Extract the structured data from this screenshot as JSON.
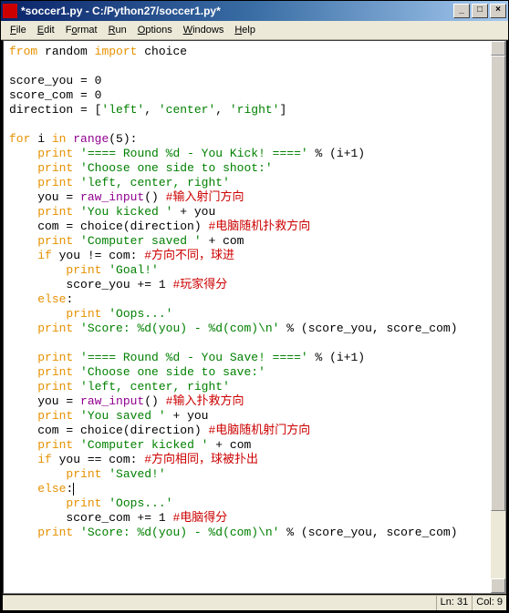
{
  "window": {
    "title": "*soccer1.py - C:/Python27/soccer1.py*",
    "min": "_",
    "max": "□",
    "close": "×"
  },
  "menu": {
    "file": "File",
    "edit": "Edit",
    "format": "Format",
    "run": "Run",
    "options": "Options",
    "windows": "Windows",
    "help": "Help"
  },
  "code": {
    "l1_kw1": "from",
    "l1_id1": " random ",
    "l1_kw2": "import",
    "l1_id2": " choice",
    "l3": "score_you = 0",
    "l4": "score_com = 0",
    "l5_a": "direction = [",
    "l5_s1": "'left'",
    "l5_c1": ", ",
    "l5_s2": "'center'",
    "l5_c2": ", ",
    "l5_s3": "'right'",
    "l5_b": "]",
    "l7_kw1": "for",
    "l7_a": " i ",
    "l7_kw2": "in",
    "l7_b": " ",
    "l7_fn": "range",
    "l7_c": "(5):",
    "l8_a": "    ",
    "l8_kw": "print",
    "l8_b": " ",
    "l8_s": "'==== Round %d - You Kick! ===='",
    "l8_c": " % (i+1)",
    "l9_a": "    ",
    "l9_kw": "print",
    "l9_b": " ",
    "l9_s": "'Choose one side to shoot:'",
    "l10_a": "    ",
    "l10_kw": "print",
    "l10_b": " ",
    "l10_s": "'left, center, right'",
    "l11_a": "    you = ",
    "l11_fn": "raw_input",
    "l11_b": "() ",
    "l11_cm": "#输入射门方向",
    "l12_a": "    ",
    "l12_kw": "print",
    "l12_b": " ",
    "l12_s": "'You kicked '",
    "l12_c": " + you",
    "l13_a": "    com = choice(direction) ",
    "l13_cm": "#电脑随机扑救方向",
    "l14_a": "    ",
    "l14_kw": "print",
    "l14_b": " ",
    "l14_s": "'Computer saved '",
    "l14_c": " + com",
    "l15_a": "    ",
    "l15_kw": "if",
    "l15_b": " you != com: ",
    "l15_cm": "#方向不同，球进",
    "l16_a": "        ",
    "l16_kw": "print",
    "l16_b": " ",
    "l16_s": "'Goal!'",
    "l17_a": "        score_you += 1 ",
    "l17_cm": "#玩家得分",
    "l18_a": "    ",
    "l18_kw": "else",
    "l18_b": ":",
    "l19_a": "        ",
    "l19_kw": "print",
    "l19_b": " ",
    "l19_s": "'Oops...'",
    "l20_a": "    ",
    "l20_kw": "print",
    "l20_b": " ",
    "l20_s": "'Score: %d(you) - %d(com)\\n'",
    "l20_c": " % (score_you, score_com)",
    "l22_a": "    ",
    "l22_kw": "print",
    "l22_b": " ",
    "l22_s": "'==== Round %d - You Save! ===='",
    "l22_c": " % (i+1)",
    "l23_a": "    ",
    "l23_kw": "print",
    "l23_b": " ",
    "l23_s": "'Choose one side to save:'",
    "l24_a": "    ",
    "l24_kw": "print",
    "l24_b": " ",
    "l24_s": "'left, center, right'",
    "l25_a": "    you = ",
    "l25_fn": "raw_input",
    "l25_b": "() ",
    "l25_cm": "#输入扑救方向",
    "l26_a": "    ",
    "l26_kw": "print",
    "l26_b": " ",
    "l26_s": "'You saved '",
    "l26_c": " + you",
    "l27_a": "    com = choice(direction) ",
    "l27_cm": "#电脑随机射门方向",
    "l28_a": "    ",
    "l28_kw": "print",
    "l28_b": " ",
    "l28_s": "'Computer kicked '",
    "l28_c": " + com",
    "l29_a": "    ",
    "l29_kw": "if",
    "l29_b": " you == com: ",
    "l29_cm": "#方向相同，球被扑出",
    "l30_a": "        ",
    "l30_kw": "print",
    "l30_b": " ",
    "l30_s": "'Saved!'",
    "l31_a": "    ",
    "l31_kw": "else",
    "l31_b": ":",
    "l32_a": "        ",
    "l32_kw": "print",
    "l32_b": " ",
    "l32_s": "'Oops...'",
    "l33_a": "        score_com += 1 ",
    "l33_cm": "#电脑得分",
    "l34_a": "    ",
    "l34_kw": "print",
    "l34_b": " ",
    "l34_s": "'Score: %d(you) - %d(com)\\n'",
    "l34_c": " % (score_you, score_com)"
  },
  "status": {
    "ln": "Ln: 31",
    "col": "Col: 9"
  }
}
